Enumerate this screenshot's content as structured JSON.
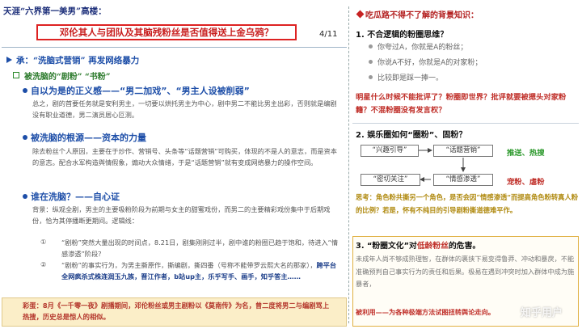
{
  "header": {
    "series_title": "天涯“六界第一美男”高楼：",
    "question": "邓伦其人与团队及其脑残粉丝是否值得送上金乌鸦？",
    "page_indicator": "4/11"
  },
  "section": {
    "title": "承：“洗脑式营销” 再发网络暴力",
    "subtitle": "被洗脑的“剧粉” “书粉”"
  },
  "points": [
    {
      "title": "自以为是的正义感——“男二加戏”、“男主人设被削弱”",
      "text": "总之，剧的首要任务就是安利男主，一切要以烘托男主为中心，剧中男二不能比男主出彩，否则就是编剧没有职业道德，男二演员居心叵测。"
    },
    {
      "title": "被洗脑的根源——资本的力量",
      "text": "除去粉丝个人原因，主要在于炒作、营销号、头条等“话题营销”可购买，体现的不是人的意志，而是资本的意志。配合水军构造舆情假象，煽动大众情绪，于是“话题营销”就有变成网络暴力的操作空间。"
    },
    {
      "title": "谁在洗脑？——自心证",
      "text": "背景：纵观全剧，男主的主要吸粉阶段为前期与女主的甜蜜戏份，而男二的主要精彩戏份集中于后期戏份，恰为其停播断更期间。逻辑线：",
      "items": [
        {
          "num": "①",
          "text": "“剧粉”突然大量出现的时间点，8.21日，剧集刚刚过半，剧中谁的粉圈已趋于饱和，待进入“情感渗透”阶段？"
        },
        {
          "num": "②",
          "text": "“剧粉”的事实行为，为男主撕原作，撕编剧，撕四番（号称不能带罗云熙大名的那家），",
          "text_bold": "跨平台全网疯杀式株连润玉九族，晋江作者，b站up主，乐乎写手、画手，知乎答主……"
        }
      ]
    }
  ],
  "bottom_note": "彩蛋：8月《一千零一夜》剧播期间，邓伦粉丝或男主剧粉以《莫南传》为名，曾二度将男二与编剧骂上热搜，历史总是惊人的相似。",
  "right": {
    "title": "吃瓜路不得不了解的背景知识：",
    "q1": {
      "heading": "1. 不合逻辑的粉圈思维？",
      "items": [
        "你夸过A，你就是A的粉丝；",
        "你说A不好，你就是A的对家粉；",
        "比较即是踩一捧一。"
      ]
    },
    "question_red": "明星什么时候不能批评了？粉圈即世界？批评就要被摁头对家粉籍？不混粉圈没有发言权？",
    "q2": {
      "heading": "2. 娱乐圈如何“圈粉”、固粉？",
      "box1": "“兴趣引导”",
      "box2": "“话题营销”",
      "label1": "推送、热搜",
      "box3": "“密切关注”",
      "box4": "“情感渗透”",
      "label2": "宠粉、虐粉",
      "note": "思考：角色粉共撕另一个角色，是否会因“情感渗透”而提高角色粉转真人粉的比例？若是，怀有不纯目的引导剧粉撕道德难平作。"
    },
    "q3": {
      "heading_prefix": "3. “粉圈文化”对",
      "heading_highlight": "低龄粉丝",
      "heading_suffix": "的危害。",
      "text": "未成年人尚不够成熟理智，在群体的裹挟下易变得鲁莽、冲动和暴戾，不能准确预判自己事实行为的责任和后果。极易在遇到冲突时加入群体中成为施暴者，",
      "text_red": "被利用——为各种极端方法试图扭转舆论走向。"
    },
    "watermark": "知乎用户"
  }
}
